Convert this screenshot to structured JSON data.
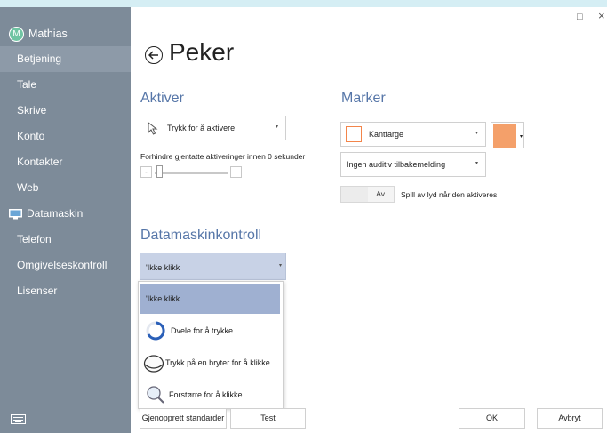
{
  "window": {
    "maximize_glyph": "□",
    "close_glyph": "×"
  },
  "sidebar": {
    "user": {
      "initial": "M",
      "name": "Mathias"
    },
    "items": [
      {
        "label": "Betjening"
      },
      {
        "label": "Tale"
      },
      {
        "label": "Skrive"
      },
      {
        "label": "Konto"
      },
      {
        "label": "Kontakter"
      },
      {
        "label": "Web"
      },
      {
        "label": "Datamaskin"
      },
      {
        "label": "Telefon"
      },
      {
        "label": "Omgivelseskontroll"
      },
      {
        "label": "Lisenser"
      }
    ],
    "active_index": 0
  },
  "header": {
    "title": "Peker"
  },
  "activate": {
    "heading": "Aktiver",
    "mode_value": "Trykk for å aktivere",
    "repeat_label": "Forhindre gjentatte aktiveringer innen 0 sekunder",
    "minus": "-",
    "plus": "+",
    "slider_value": 0
  },
  "marker": {
    "heading": "Marker",
    "border_value": "Kantfarge",
    "color": "#f4a06a",
    "audio_value": "Ingen auditiv tilbakemelding",
    "toggle_state": "Av",
    "toggle_label": "Spill av lyd når den aktiveres"
  },
  "computer_control": {
    "heading": "Datamaskinkontroll",
    "selected": "'Ikke klikk",
    "options": [
      {
        "label": "'Ikke klikk",
        "icon": "none"
      },
      {
        "label": "Dvele for å trykke",
        "icon": "dwell-ring-icon"
      },
      {
        "label": "Trykk på en bryter for å klikke",
        "icon": "switch-icon"
      },
      {
        "label": "Forstørre for å klikke",
        "icon": "magnifier-icon"
      }
    ]
  },
  "footer": {
    "restore": "Gjenopprett standarder",
    "test": "Test",
    "ok": "OK",
    "cancel": "Avbryt"
  }
}
